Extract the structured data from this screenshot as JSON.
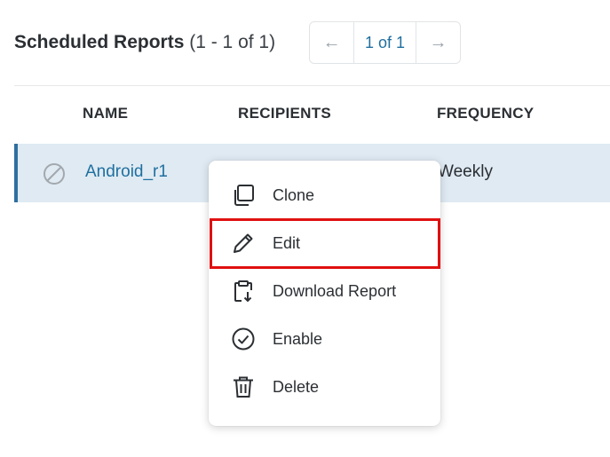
{
  "header": {
    "title": "Scheduled Reports",
    "count": "(1 - 1 of 1)"
  },
  "pager": {
    "prev_icon": "arrow-left-icon",
    "prev_glyph": "←",
    "current": "1 of 1",
    "next_icon": "arrow-right-icon",
    "next_glyph": "→"
  },
  "table": {
    "columns": [
      "NAME",
      "RECIPIENTS",
      "FREQUENCY"
    ],
    "rows": [
      {
        "status_icon": "disabled-icon",
        "name": "Android_r1",
        "recipients": "",
        "frequency": "Weekly",
        "selected": true
      }
    ]
  },
  "context_menu": {
    "items": [
      {
        "label": "Clone",
        "icon": "clone-icon"
      },
      {
        "label": "Edit",
        "icon": "pencil-icon",
        "highlighted": true
      },
      {
        "label": "Download Report",
        "icon": "clipboard-download-icon"
      },
      {
        "label": "Enable",
        "icon": "check-circle-icon"
      },
      {
        "label": "Delete",
        "icon": "trash-icon"
      }
    ]
  },
  "colors": {
    "accent": "#1f6f9f",
    "row_selected_bg": "#dfeaf3",
    "row_selected_border": "#2f6f9f",
    "highlight": "#e01010"
  }
}
